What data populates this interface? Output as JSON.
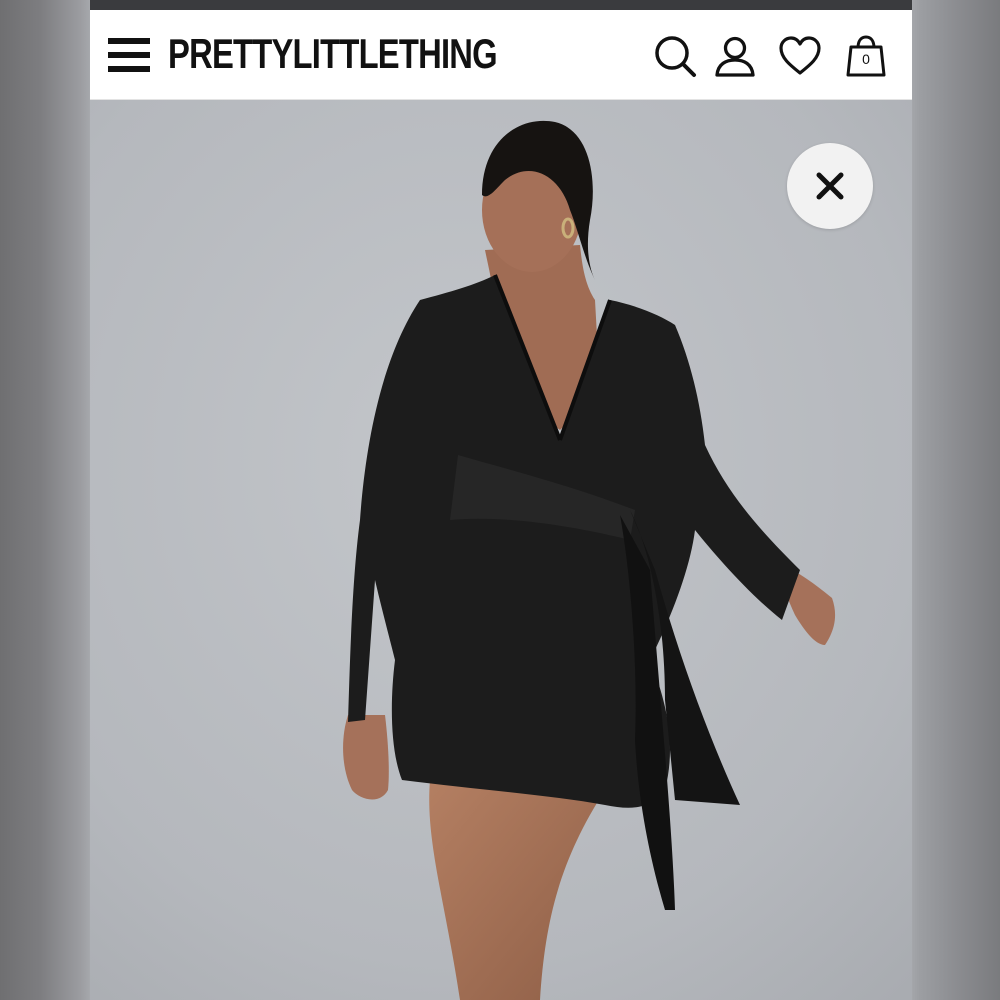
{
  "header": {
    "logo_text": "PRETTYLITTLETHING",
    "menu_icon": "hamburger-menu-icon",
    "search_icon": "search-icon",
    "account_icon": "user-icon",
    "wishlist_icon": "heart-icon",
    "bag_icon": "shopping-bag-icon",
    "bag_count": "0"
  },
  "product_image": {
    "close_icon": "close-icon"
  },
  "colors": {
    "header_bg": "#ffffff",
    "text": "#111111",
    "backdrop": "#b9bcc0",
    "dress": "#1c1c1c"
  }
}
